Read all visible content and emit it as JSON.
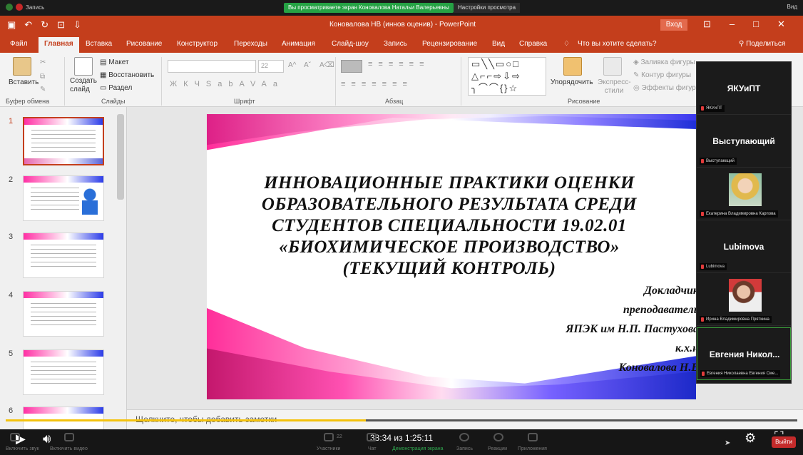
{
  "zoom_top": {
    "record_label": "Запись",
    "share_banner": "Вы просматриваете экран Коноваловa Натальи Валерьевны",
    "view_settings": "Настройки просмотра",
    "view_label": "Вид"
  },
  "window": {
    "doc_title": "Коновалова НВ (иннов оценив) - PowerPoint",
    "login_label": "Вход"
  },
  "tabs": [
    "Файл",
    "Главная",
    "Вставка",
    "Рисование",
    "Конструктор",
    "Переходы",
    "Анимация",
    "Слайд-шоу",
    "Запись",
    "Рецензирование",
    "Вид",
    "Справка"
  ],
  "tell_me": "Что вы хотите сделать?",
  "share_label": "Поделиться",
  "ribbon": {
    "paste": "Вставить",
    "clipboard_group": "Буфер обмена",
    "new_slide": "Создать слайд",
    "layout": "Макет",
    "reset": "Восстановить",
    "section": "Раздел",
    "slides_group": "Слайды",
    "font_size": "22",
    "font_group": "Шрифт",
    "paragraph_group": "Абзац",
    "arrange": "Упорядочить",
    "quick_styles": "Экспресс-стили",
    "shape_fill": "Заливка фигуры",
    "shape_outline": "Контур фигуры",
    "shape_effects": "Эффекты фигуры",
    "drawing_group": "Рисование"
  },
  "thumbnails": [
    "1",
    "2",
    "3",
    "4",
    "5",
    "6"
  ],
  "slide": {
    "title_lines": [
      "ИННОВАЦИОННЫЕ ПРАКТИКИ ОЦЕНКИ",
      "ОБРАЗОВАТЕЛЬНОГО РЕЗУЛЬТАТА СРЕДИ",
      "СТУДЕНТОВ СПЕЦИАЛЬНОСТИ 19.02.01",
      "«БИОХИМИЧЕСКОЕ ПРОИЗВОДСТВО»",
      "(ТЕКУЩИЙ КОНТРОЛЬ)"
    ],
    "speaker_lines": [
      "Докладчик",
      "преподаватель",
      "ЯПЭК им Н.П. Пастухова",
      "к.х.н",
      "Коновалова Н.В"
    ]
  },
  "notes_placeholder": "Щелкните, чтобы добавить заметки",
  "participants": [
    {
      "big": "ЯКУиПТ",
      "tag": "ЯКУиПТ"
    },
    {
      "big": "Выступающий",
      "tag": "Выступающий"
    },
    {
      "big": "",
      "tag": "Екатерина Владимировна Карпова"
    },
    {
      "big": "Lubimova",
      "tag": "Lubimova"
    },
    {
      "big": "",
      "tag": "Ирина Владимировна Пряткина"
    },
    {
      "big": "Евгения Никол...",
      "tag": "Евгения Николаевна Евгения Сме..."
    }
  ],
  "player": {
    "time": "38:34 из 1:25:11",
    "progress_fraction": 0.455
  },
  "zoom_bottom": {
    "mute": "Включить звук",
    "video": "Включить видео",
    "participants": "Участники",
    "participants_count": "22",
    "chat": "Чат",
    "share": "Демонстрация экрана",
    "record": "Запись",
    "reactions": "Реакции",
    "apps": "Приложения",
    "leave": "Выйти"
  }
}
